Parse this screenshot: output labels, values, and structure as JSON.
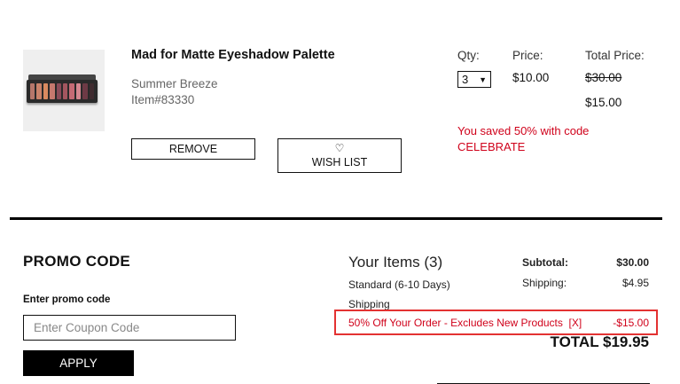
{
  "product": {
    "name": "Mad for Matte Eyeshadow Palette",
    "shade": "Summer Breeze",
    "item_number": "Item#83330",
    "palette_colors": [
      "#b5766a",
      "#c9826a",
      "#d98a5f",
      "#c6786e",
      "#8a4a58",
      "#a3565f",
      "#c56a74",
      "#d58790",
      "#6d3a45",
      "#3f2b2f"
    ],
    "remove_label": "REMOVE",
    "wishlist_label": "WISH LIST"
  },
  "columns": {
    "qty_label": "Qty:",
    "price_label": "Price:",
    "total_label": "Total Price:"
  },
  "line": {
    "qty": "3",
    "price": "$10.00",
    "original_total": "$30.00",
    "discounted_total": "$15.00",
    "savings_message": "You saved 50% with code CELEBRATE"
  },
  "promo": {
    "heading": "PROMO CODE",
    "label": "Enter promo code",
    "placeholder": "Enter Coupon Code",
    "apply_label": "APPLY"
  },
  "summary": {
    "items_heading": "Your Items (3)",
    "shipping_method": "Standard (6-10 Days) Shipping",
    "subtotal_label": "Subtotal:",
    "subtotal_value": "$30.00",
    "shipping_label": "Shipping:",
    "shipping_value": "$4.95",
    "discount_label": "50% Off Your Order - Excludes New Products  [X]",
    "discount_value": "-$15.00",
    "total": "TOTAL $19.95"
  },
  "colors": {
    "accent_red": "#d0021b",
    "highlight_border": "#e33232"
  }
}
